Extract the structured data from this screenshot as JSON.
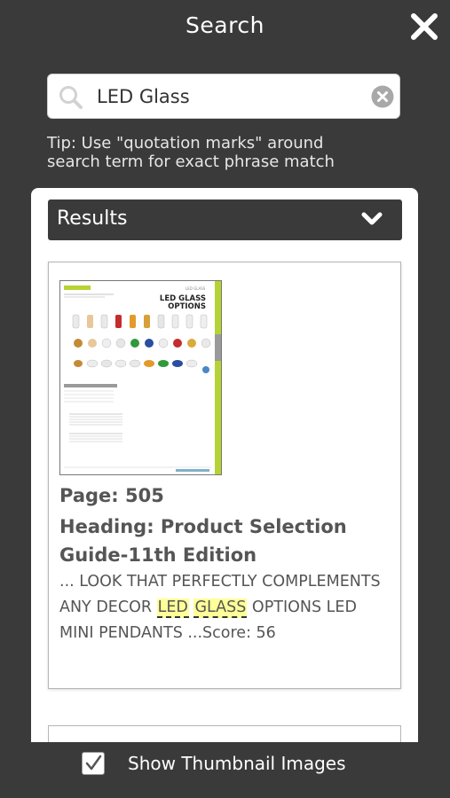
{
  "header": {
    "title": "Search"
  },
  "search": {
    "value": "LED Glass",
    "placeholder": ""
  },
  "tip": {
    "line1": "Tip: Use \"quotation marks\" around",
    "line2": "search term for exact phrase match"
  },
  "results": {
    "label": "Results",
    "items": [
      {
        "page": "Page: 505",
        "heading": "Heading: Product Selection Guide-11th Edition",
        "snippet_pre": "... LOOK THAT PERFECTLY COMPLEMENTS ANY DECOR ",
        "highlight_1": "LED",
        "highlight_2": "GLASS",
        "snippet_post": " OPTIONS LED MINI PENDANTS ...Score: 56",
        "thumbnail": {
          "title_line1": "LED GLASS",
          "title_line2": "OPTIONS"
        }
      }
    ]
  },
  "footer": {
    "show_thumbnails_label": "Show Thumbnail Images",
    "show_thumbnails_checked": true
  },
  "colors": {
    "background": "#3a3a3a",
    "highlight": "#ffff99",
    "thumbnail_accent": "#b5d334"
  }
}
